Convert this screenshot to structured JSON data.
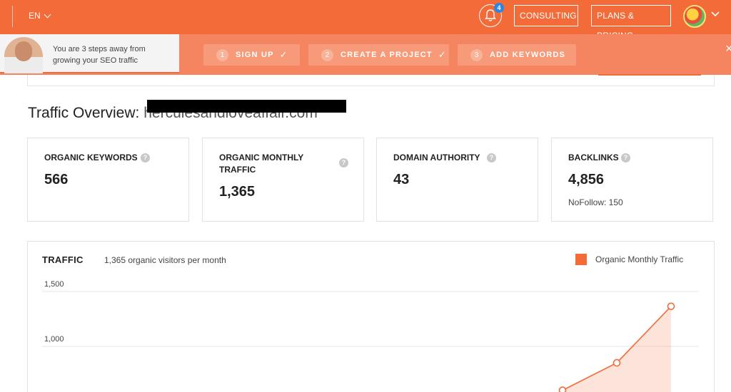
{
  "header": {
    "language": "EN",
    "notifications_count": "4",
    "consulting_label": "CONSULTING",
    "plans_label": "PLANS & PRICING"
  },
  "onboarding": {
    "promo_text": "You are 3 steps away from growing your SEO traffic",
    "steps": [
      {
        "num": "1",
        "label": "SIGN UP",
        "done": true
      },
      {
        "num": "2",
        "label": "CREATE A PROJECT",
        "done": true
      },
      {
        "num": "3",
        "label": "ADD KEYWORDS",
        "done": false
      }
    ],
    "close_label": "×"
  },
  "overview": {
    "title": "Traffic Overview:",
    "domain": "herculesandloveaffair.com"
  },
  "metrics": [
    {
      "label": "ORGANIC KEYWORDS",
      "value": "566",
      "sub": ""
    },
    {
      "label": "ORGANIC MONTHLY TRAFFIC",
      "value": "1,365",
      "sub": ""
    },
    {
      "label": "DOMAIN AUTHORITY",
      "value": "43",
      "sub": ""
    },
    {
      "label": "BACKLINKS",
      "value": "4,856",
      "sub": "NoFollow: 150"
    }
  ],
  "traffic_chart": {
    "title": "TRAFFIC",
    "subtitle": "1,365 organic visitors per month",
    "legend": "Organic Monthly Traffic",
    "color": "#f26b38"
  },
  "chart_data": {
    "type": "area",
    "series": [
      {
        "name": "Organic Monthly Traffic",
        "values": [
          600,
          850,
          1365
        ]
      }
    ],
    "y_ticks": [
      "1,500",
      "1,000"
    ],
    "tick_values": [
      1500,
      1000
    ],
    "ylim": [
      500,
      1650
    ],
    "grid": true,
    "legend": "top-right"
  }
}
